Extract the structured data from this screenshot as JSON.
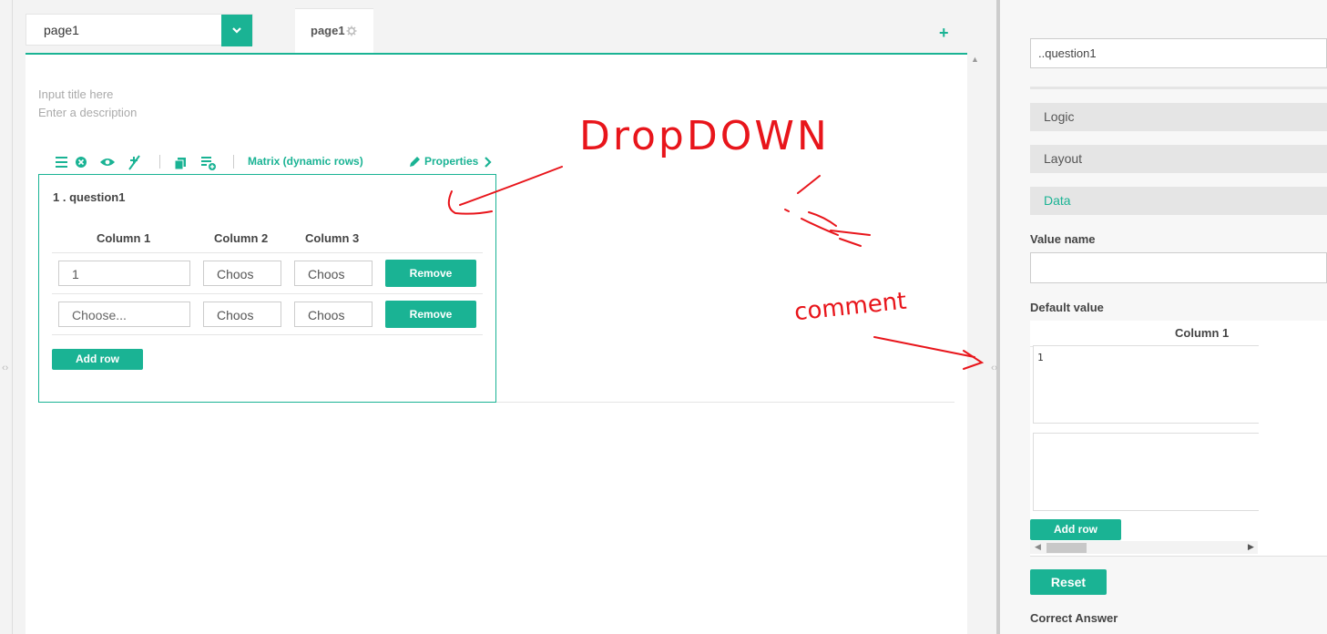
{
  "editor": {
    "page_select_value": "page1",
    "page_tab_label": "page1",
    "title_placeholder": "Input title here",
    "description_placeholder": "Enter a description",
    "question": {
      "type_label": "Matrix (dynamic rows)",
      "properties_label": "Properties",
      "title": "1 . question1",
      "columns": [
        "Column 1",
        "Column 2",
        "Column 3"
      ],
      "rows": [
        {
          "c1": "1",
          "c2": "Choos",
          "c3": "Choos",
          "remove": "Remove"
        },
        {
          "c1": "Choose...",
          "c2": "Choos",
          "c3": "Choos",
          "remove": "Remove"
        }
      ],
      "add_row_label": "Add row"
    }
  },
  "annotations": {
    "dropdown": "DropDOWN",
    "comment": "comment"
  },
  "properties_panel": {
    "object_select_value": "..question1",
    "sections": [
      "Logic",
      "Layout",
      "Data"
    ],
    "value_name_label": "Value name",
    "value_name_value": "",
    "default_value_label": "Default value",
    "default_value_column": "Column 1",
    "default_value_rows": [
      "1",
      ""
    ],
    "add_row_label": "Add row",
    "reset_label": "Reset",
    "correct_answer_label": "Correct Answer"
  },
  "colors": {
    "accent": "#1ab394",
    "annotation": "#e8151b"
  }
}
